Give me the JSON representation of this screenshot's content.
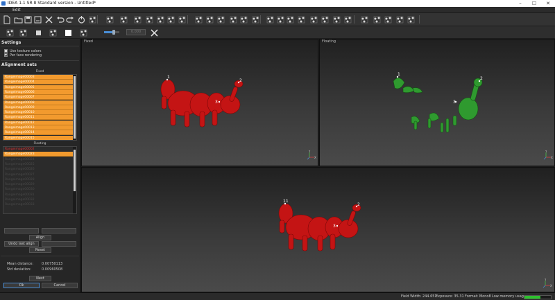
{
  "window": {
    "title": "IDEA 1.1 SR 8 Standard version - Untitled*"
  },
  "menu": {
    "items": [
      "Edit"
    ]
  },
  "toolbar_top": {
    "icons": [
      "new-file-icon",
      "open-folder-icon",
      "save-icon",
      "save-as-icon",
      "delete-icon",
      "undo-icon",
      "redo-icon",
      "power-icon",
      "eraser-icon",
      "scatter-points-icon",
      "sphere-icon",
      "sphere-outline-icon",
      "mesh-icon",
      "pipe-icon",
      "network-icon",
      "dots-icon",
      "grid-dots-icon",
      "grid-icon",
      "grid-select-icon",
      "triangle-flag-icon",
      "scatter-select-icon",
      "connect-icon",
      "hook-icon",
      "curve-icon",
      "rectangle-icon",
      "ellipse-icon",
      "lasso-icon",
      "polygon-icon",
      "split-line-icon",
      "flat-line-icon",
      "window-icon",
      "scale-icon",
      "plane-icon",
      "zoom-icon",
      "resize-icon"
    ]
  },
  "toolbar_bottom": {
    "icons": [
      "settings-gear-icon",
      "group-icon",
      "square-solid-icon",
      "unlink-icon",
      "square-white-icon",
      "shield-check-icon",
      "tools-icon"
    ],
    "slider_value": 0.62,
    "number_field_placeholder": "0.000"
  },
  "settings": {
    "title": "Settings",
    "use_texture_colors": {
      "label": "Use texture colors",
      "checked": false
    },
    "per_face_rendering": {
      "label": "Per face rendering",
      "checked": true
    }
  },
  "alignment": {
    "title": "Alignment sets",
    "fixed_header": "Fixed",
    "fixed_items": [
      "Rangeimage00003",
      "Rangeimage00004",
      "Rangeimage00005",
      "Rangeimage00006",
      "Rangeimage00007",
      "Rangeimage00008",
      "Rangeimage00009",
      "Rangeimage00010",
      "Rangeimage00011",
      "Rangeimage00012",
      "Rangeimage00013",
      "Rangeimage00014",
      "Rangeimage00015"
    ],
    "floating_header": "Floating",
    "floating_items": [
      "Rangeimage00002",
      "Rangeimage00023",
      "Rangeimage00024",
      "Rangeimage00025",
      "Rangeimage00026",
      "Rangeimage00027",
      "Rangeimage00028",
      "Rangeimage00029",
      "Rangeimage00030",
      "Rangeimage00031",
      "Rangeimage00032",
      "Rangeimage00033"
    ]
  },
  "buttons": {
    "align": "Align",
    "undo_last_align": "Undo last align",
    "reset": "Reset",
    "next": "Next",
    "ok": "Ok",
    "cancel": "Cancel"
  },
  "stats": {
    "mean_distance_label": "Mean distance:",
    "mean_distance_value": "0.00750113",
    "std_deviation_label": "Std deviation:",
    "std_deviation_value": "0.00960508"
  },
  "views": {
    "fixed_label": "Fixed",
    "floating_label": "Floating",
    "fixed_points": [
      "1",
      "2",
      "3"
    ],
    "floating_points": [
      "1",
      "2",
      "3"
    ],
    "result_points": [
      "11",
      "2",
      "3"
    ],
    "axis_labels": {
      "y": "Y",
      "x": "X"
    }
  },
  "status": {
    "field_width": "Field Width: 244.651",
    "exposure": "Exposure: 35.31",
    "format": "Format: Mono8",
    "memory": "Low memory usage",
    "memory_fraction": 0.6
  },
  "colors": {
    "selection": "#f29a2e",
    "fixed_model": "#c41414",
    "floating_model": "#2f9a2f",
    "accent": "#4a8fd8",
    "memory_ok": "#2ec22e"
  }
}
